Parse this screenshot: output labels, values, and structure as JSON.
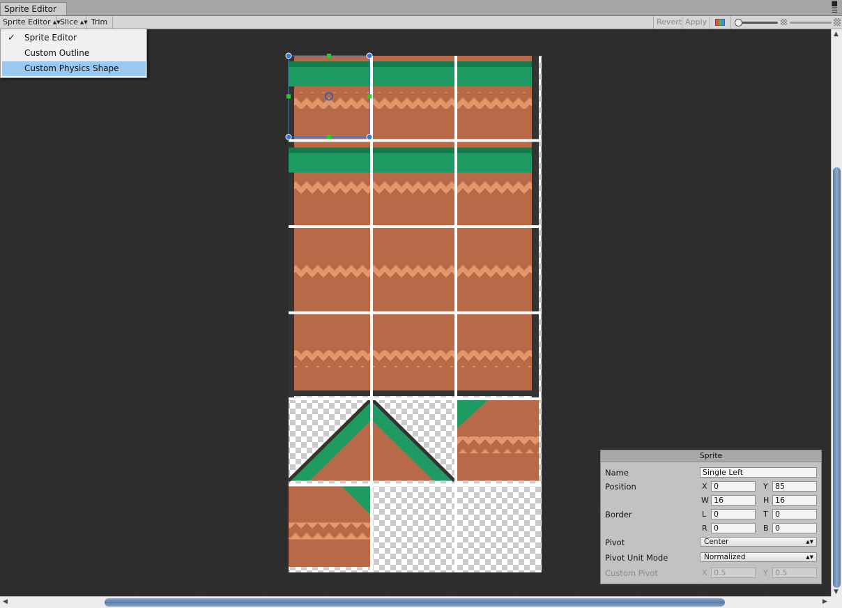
{
  "window": {
    "tab_title": "Sprite Editor",
    "lock_icon": "lock-icon",
    "menu_icon": "context-menu-icon"
  },
  "toolbar": {
    "mode_label": "Sprite Editor",
    "slice_label": "Slice",
    "trim_label": "Trim",
    "revert_label": "Revert",
    "apply_label": "Apply"
  },
  "mode_menu": {
    "items": [
      {
        "label": "Sprite Editor",
        "checked": true
      },
      {
        "label": "Custom Outline",
        "checked": false
      },
      {
        "label": "Custom Physics Shape",
        "highlighted": true
      }
    ]
  },
  "inspector": {
    "title": "Sprite",
    "name_label": "Name",
    "name_value": "Single Left",
    "position_label": "Position",
    "x_label": "X",
    "x_value": "0",
    "y_label": "Y",
    "y_value": "85",
    "w_label": "W",
    "w_value": "16",
    "h_label": "H",
    "h_value": "16",
    "border_label": "Border",
    "l_label": "L",
    "l_value": "0",
    "t_label": "T",
    "t_value": "0",
    "r_label": "R",
    "r_value": "0",
    "b_label": "B",
    "b_value": "0",
    "pivot_label": "Pivot",
    "pivot_value": "Center",
    "pivot_unit_label": "Pivot Unit Mode",
    "pivot_unit_value": "Normalized",
    "custom_pivot_label": "Custom Pivot",
    "cpx_label": "X",
    "cpx_value": "0.5",
    "cpy_label": "Y",
    "cpy_value": "0.5"
  },
  "colors": {
    "grass": "#1f9a63",
    "grass_dark": "#157a4c",
    "dirt": "#b86a48",
    "dirt_light": "#e1986a",
    "outline": "#333333",
    "selection": "#3a78d8",
    "handle": "#22d322",
    "menu_highlight": "#99c9ef"
  },
  "sheet": {
    "tiles": [
      "top-left",
      "top-mid",
      "top-right",
      "top-left",
      "top-mid",
      "top-right",
      "mid-left",
      "mid",
      "mid-right",
      "bot-left",
      "bot-mid",
      "bot-right",
      "slope-left",
      "slope-right",
      "corner-br",
      "corner-bl",
      "empty",
      "empty"
    ]
  }
}
